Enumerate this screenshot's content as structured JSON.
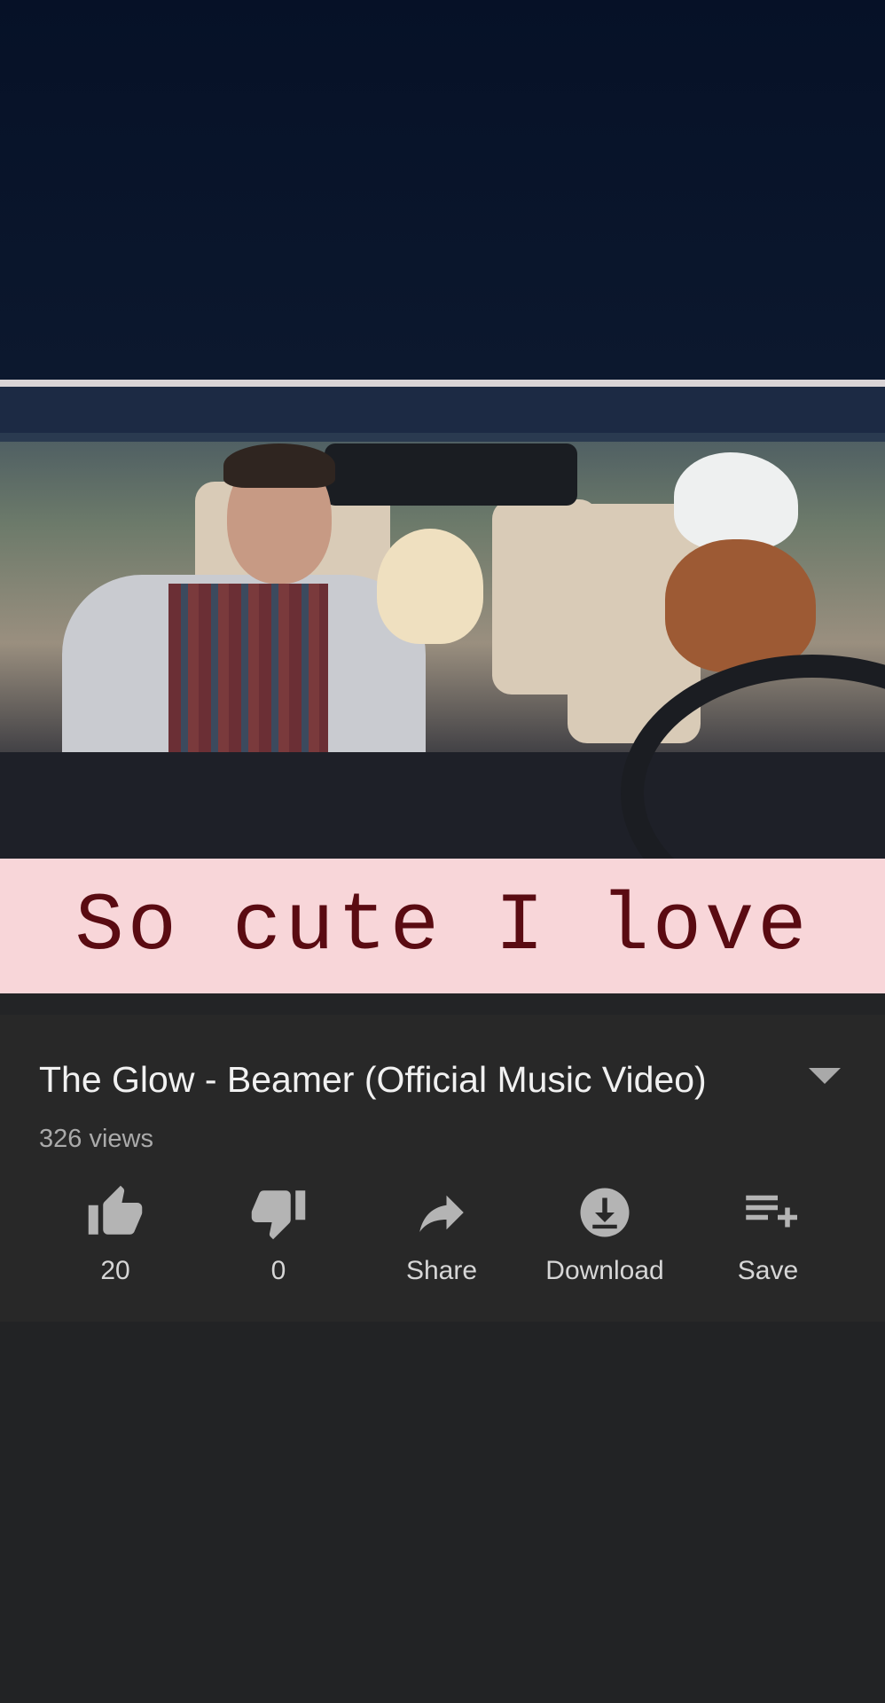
{
  "caption": {
    "text": "So cute I love"
  },
  "video": {
    "title": "The Glow - Beamer (Official Music Video)",
    "views": "326 views"
  },
  "actions": [
    {
      "icon": "thumbs-up-icon",
      "label": "20"
    },
    {
      "icon": "thumbs-down-icon",
      "label": "0"
    },
    {
      "icon": "share-icon",
      "label": "Share"
    },
    {
      "icon": "download-icon",
      "label": "Download"
    },
    {
      "icon": "save-playlist-icon",
      "label": "Save"
    }
  ],
  "colors": {
    "caption_bg": "#f8d6d9",
    "caption_text": "#5a0b12",
    "panel_bg": "#282828"
  }
}
